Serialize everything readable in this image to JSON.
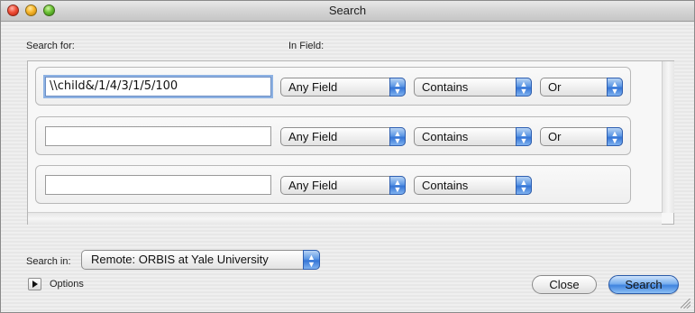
{
  "window": {
    "title": "Search"
  },
  "headers": {
    "search_for": "Search for:",
    "in_field": "In Field:"
  },
  "rows": [
    {
      "term": "\\\\child&/1/4/3/1/5/100",
      "field": "Any Field",
      "operator": "Contains",
      "conjunction": "Or"
    },
    {
      "term": "",
      "field": "Any Field",
      "operator": "Contains",
      "conjunction": "Or"
    },
    {
      "term": "",
      "field": "Any Field",
      "operator": "Contains"
    }
  ],
  "search_in": {
    "label": "Search in:",
    "value": "Remote: ORBIS at Yale University"
  },
  "options": {
    "label": "Options"
  },
  "buttons": {
    "close": "Close",
    "search": "Search"
  },
  "icons": {
    "popup": "up-down-arrows-icon",
    "disclosure": "disclosure-triangle-icon"
  }
}
